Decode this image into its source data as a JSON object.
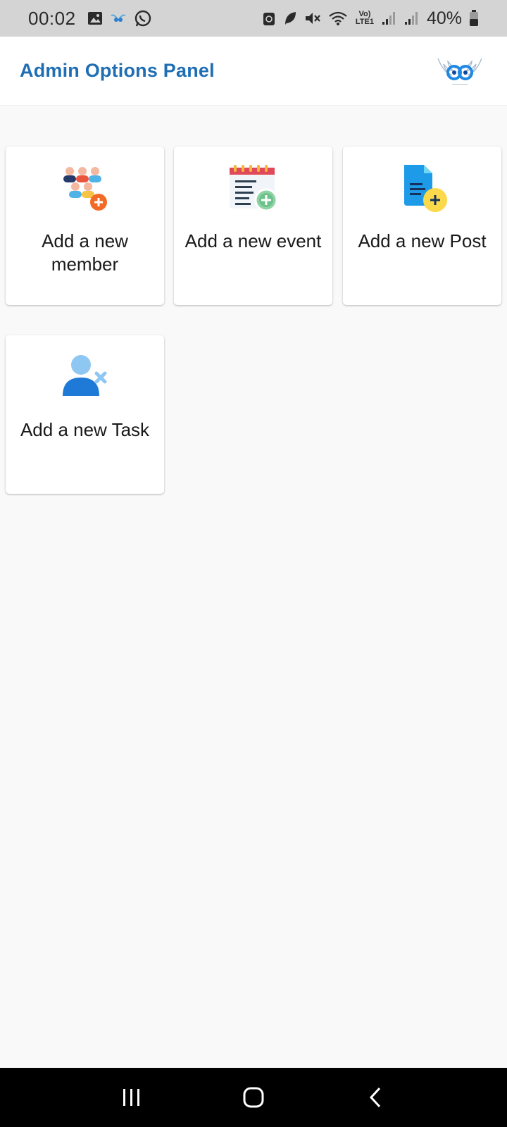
{
  "status_bar": {
    "time": "00:02",
    "battery": "40%",
    "network_label": "Vo) LTE1"
  },
  "header": {
    "title": "Admin Options Panel",
    "logo_icon": "owl-wings-logo"
  },
  "options": [
    {
      "label": "Add a new member",
      "icon": "add-member-icon"
    },
    {
      "label": "Add a new event",
      "icon": "add-event-icon"
    },
    {
      "label": "Add a new Post",
      "icon": "add-post-icon"
    },
    {
      "label": "Add a new Task",
      "icon": "add-task-icon"
    }
  ],
  "navigation": {
    "recents": "recents-icon",
    "home": "home-icon",
    "back": "back-icon"
  },
  "colors": {
    "title_blue": "#1f6eb4",
    "background": "#f9f9f9",
    "status_bar": "#d4d4d4",
    "nav_bar": "#000000"
  }
}
